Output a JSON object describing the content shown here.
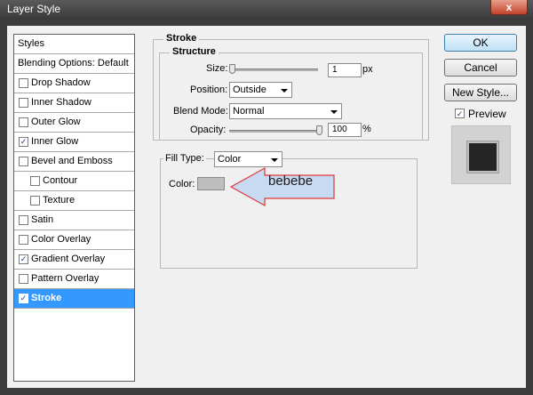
{
  "window": {
    "title": "Layer Style",
    "close_glyph": "x"
  },
  "styles_list": {
    "items": [
      {
        "label": "Styles",
        "checkbox": false,
        "checked": false,
        "indent": false,
        "selected": false
      },
      {
        "label": "Blending Options: Default",
        "checkbox": false,
        "checked": false,
        "indent": false,
        "selected": false
      },
      {
        "label": "Drop Shadow",
        "checkbox": true,
        "checked": false,
        "indent": false,
        "selected": false
      },
      {
        "label": "Inner Shadow",
        "checkbox": true,
        "checked": false,
        "indent": false,
        "selected": false
      },
      {
        "label": "Outer Glow",
        "checkbox": true,
        "checked": false,
        "indent": false,
        "selected": false
      },
      {
        "label": "Inner Glow",
        "checkbox": true,
        "checked": true,
        "indent": false,
        "selected": false
      },
      {
        "label": "Bevel and Emboss",
        "checkbox": true,
        "checked": false,
        "indent": false,
        "selected": false
      },
      {
        "label": "Contour",
        "checkbox": true,
        "checked": false,
        "indent": true,
        "selected": false
      },
      {
        "label": "Texture",
        "checkbox": true,
        "checked": false,
        "indent": true,
        "selected": false
      },
      {
        "label": "Satin",
        "checkbox": true,
        "checked": false,
        "indent": false,
        "selected": false
      },
      {
        "label": "Color Overlay",
        "checkbox": true,
        "checked": false,
        "indent": false,
        "selected": false
      },
      {
        "label": "Gradient Overlay",
        "checkbox": true,
        "checked": true,
        "indent": false,
        "selected": false
      },
      {
        "label": "Pattern Overlay",
        "checkbox": true,
        "checked": false,
        "indent": false,
        "selected": false
      },
      {
        "label": "Stroke",
        "checkbox": true,
        "checked": true,
        "indent": false,
        "selected": true
      }
    ]
  },
  "stroke": {
    "title": "Stroke",
    "structure_title": "Structure",
    "size_label": "Size:",
    "size_value": "1",
    "size_unit": "px",
    "size_slider_fraction": 0.0,
    "position_label": "Position:",
    "position_value": "Outside",
    "blend_mode_label": "Blend Mode:",
    "blend_mode_value": "Normal",
    "opacity_label": "Opacity:",
    "opacity_value": "100",
    "opacity_unit": "%",
    "opacity_slider_fraction": 1.0,
    "fill_type_label": "Fill Type:",
    "fill_type_value": "Color",
    "color_label": "Color:",
    "color_hex": "#bebebe"
  },
  "callout": {
    "text": "bebebe",
    "color": "#c8daf2",
    "border": "#e0373a"
  },
  "buttons": {
    "ok": "OK",
    "cancel": "Cancel",
    "new_style": "New Style..."
  },
  "preview": {
    "label": "Preview",
    "checked": true
  }
}
